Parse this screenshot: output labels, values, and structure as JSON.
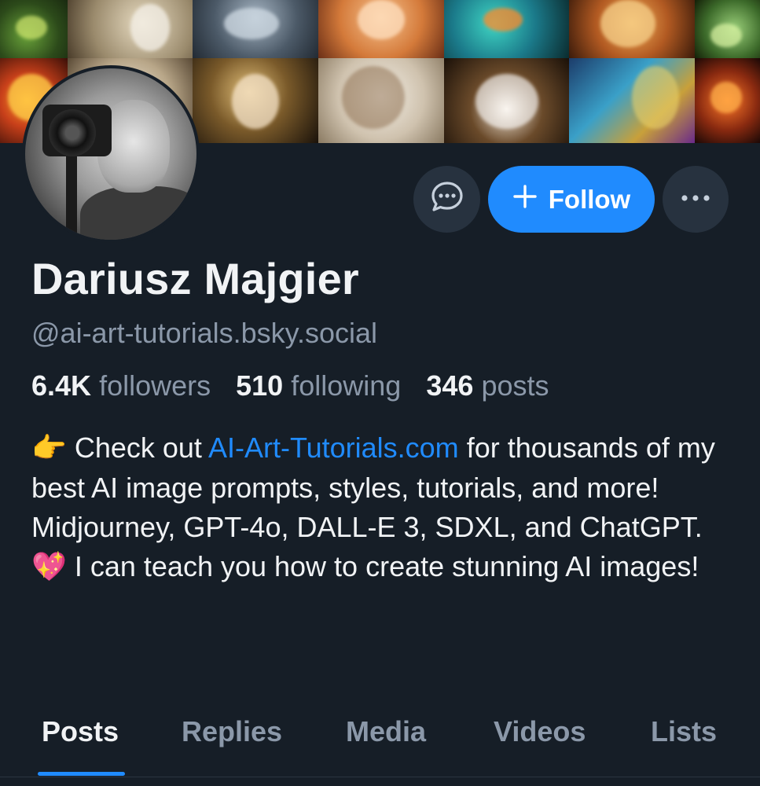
{
  "profile": {
    "display_name": "Dariusz Majgier",
    "handle": "@ai-art-tutorials.bsky.social",
    "stats": {
      "followers_count": "6.4K",
      "followers_label": "followers",
      "following_count": "510",
      "following_label": "following",
      "posts_count": "346",
      "posts_label": "posts"
    },
    "bio": {
      "line1_emoji": "👉",
      "line1_before": "Check out",
      "line1_link": "AI-Art-Tutorials.com",
      "line1_after": "for thousands of my best AI image prompts, styles, tutorials, and more! Midjourney, GPT-4o, DALL-E 3, SDXL, and ChatGPT.",
      "line2_emoji": "💖",
      "line2_text": "I can teach you how to create stunning AI images!"
    }
  },
  "actions": {
    "message_icon": "chat-bubble-icon",
    "follow_label": "Follow",
    "follow_icon": "plus-icon",
    "more_icon": "ellipsis-icon"
  },
  "tabs": [
    {
      "label": "Posts",
      "active": true
    },
    {
      "label": "Replies",
      "active": false
    },
    {
      "label": "Media",
      "active": false
    },
    {
      "label": "Videos",
      "active": false
    },
    {
      "label": "Lists",
      "active": false
    }
  ],
  "colors": {
    "background": "#161e27",
    "accent": "#208bfe",
    "muted_text": "#8b98a9",
    "button_bg": "#27323f"
  }
}
